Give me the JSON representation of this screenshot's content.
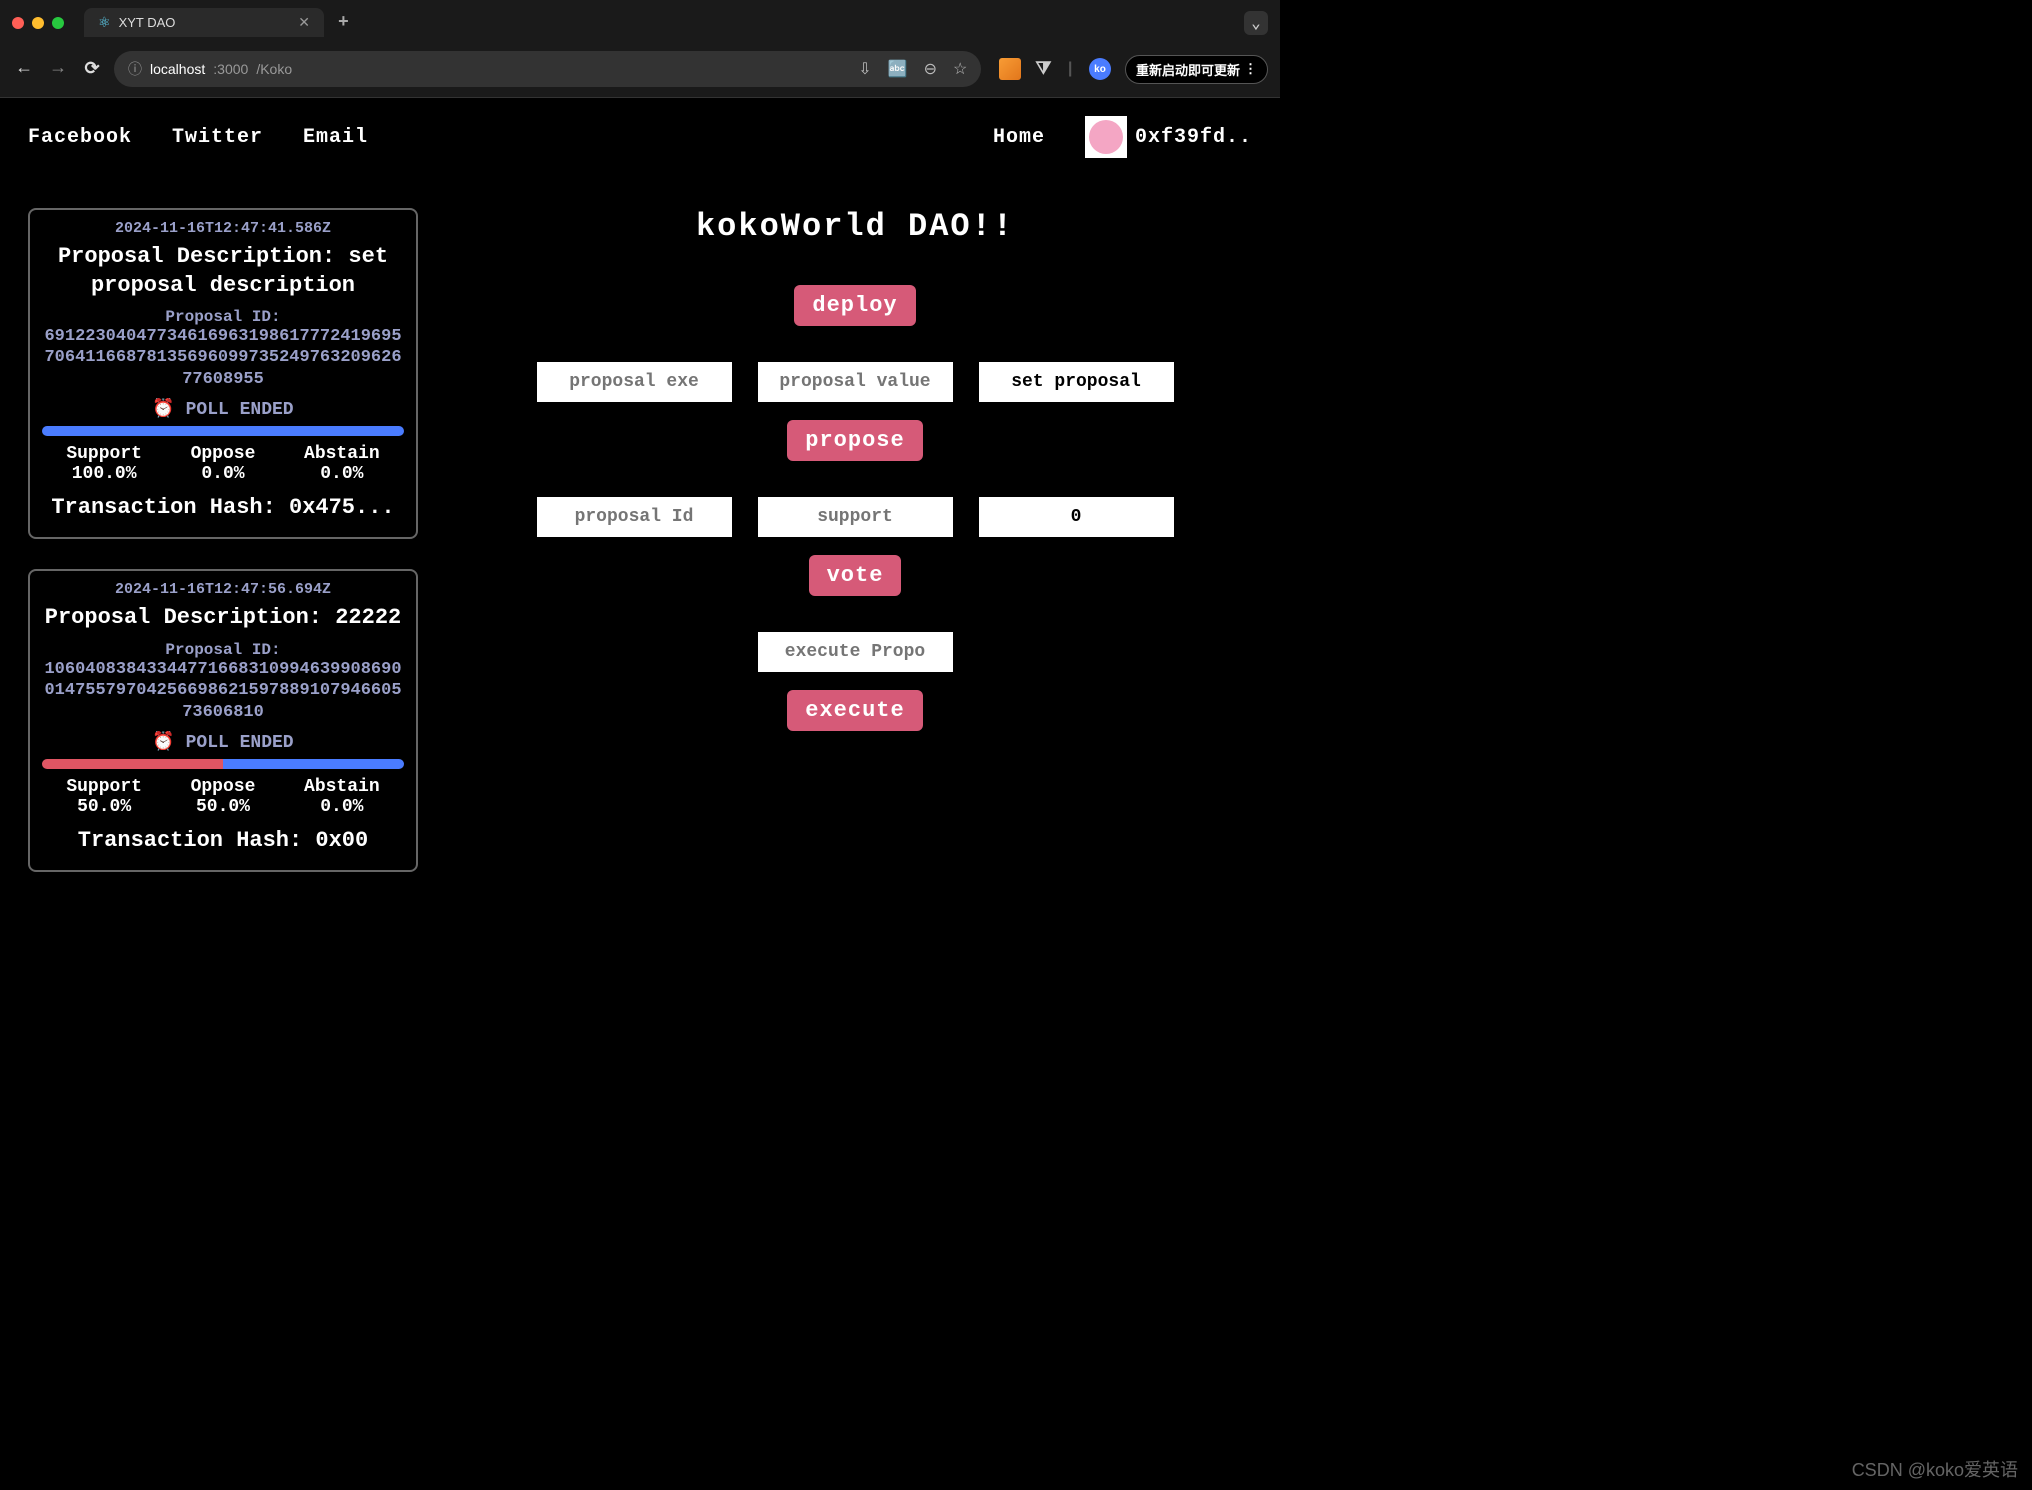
{
  "browser": {
    "tab_title": "XYT DAO",
    "url_host": "localhost",
    "url_port": ":3000",
    "url_path": "/Koko",
    "avatar_text": "ko",
    "update_label": "重新启动即可更新"
  },
  "nav": {
    "facebook": "Facebook",
    "twitter": "Twitter",
    "email": "Email",
    "home": "Home",
    "wallet": "0xf39fd.."
  },
  "main": {
    "title": "kokoWorld DAO!!",
    "deploy": "deploy",
    "propose": {
      "exe_placeholder": "proposal exe",
      "value_placeholder": "proposal value",
      "desc_value": "set proposal",
      "button": "propose"
    },
    "vote": {
      "id_placeholder": "proposal Id",
      "support_placeholder": "support",
      "amount_value": "0",
      "button": "vote"
    },
    "execute": {
      "placeholder": "execute Propo",
      "button": "execute"
    }
  },
  "proposals": [
    {
      "timestamp": "2024-11-16T12:47:41.586Z",
      "description": "Proposal Description: set proposal description",
      "pid_label": "Proposal ID:",
      "pid": "691223040477346169631986177724196957064116687813569609973524976320962677608955",
      "poll_ended": "POLL ENDED",
      "support_label": "Support",
      "support_val": "100.0%",
      "oppose_label": "Oppose",
      "oppose_val": "0.0%",
      "abstain_label": "Abstain",
      "abstain_val": "0.0%",
      "txhash": "Transaction Hash: 0x475...",
      "support_pct": 100,
      "oppose_pct": 0
    },
    {
      "timestamp": "2024-11-16T12:47:56.694Z",
      "description": "Proposal Description: 22222",
      "pid_label": "Proposal ID:",
      "pid": "106040838433447716683109946399086900147557970425669862159788910794660573606810",
      "poll_ended": "POLL ENDED",
      "support_label": "Support",
      "support_val": "50.0%",
      "oppose_label": "Oppose",
      "oppose_val": "50.0%",
      "abstain_label": "Abstain",
      "abstain_val": "0.0%",
      "txhash": "Transaction Hash: 0x00",
      "support_pct": 50,
      "oppose_pct": 50
    }
  ],
  "watermark": "CSDN @koko爱英语"
}
